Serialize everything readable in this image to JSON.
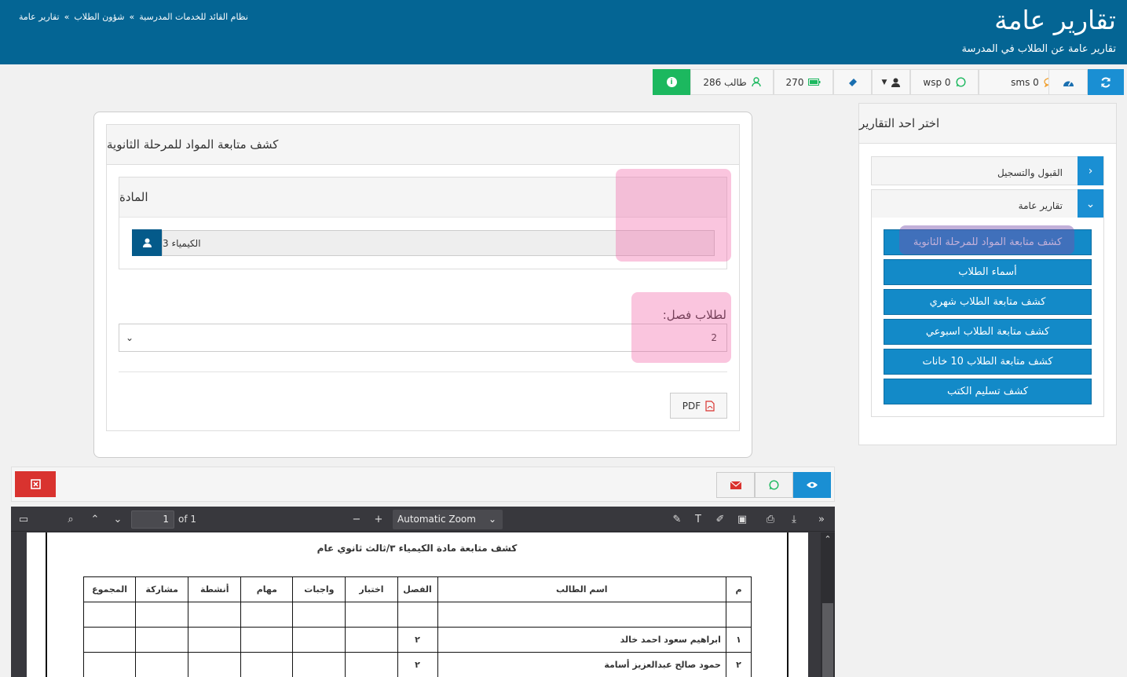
{
  "header": {
    "title": "تقارير عامة",
    "subtitle": "تقارير عامة عن الطلاب في المدرسة",
    "breadcrumb": [
      "نظام القائد للخدمات المدرسية",
      "شؤون الطلاب",
      "تقارير عامة"
    ],
    "separator": "»"
  },
  "toolbar": {
    "students": "286 طالب",
    "battery": "270",
    "wsp": "wsp 0",
    "sms": "sms 0"
  },
  "right_panel": {
    "title": "اختر احد التقارير",
    "sections": [
      {
        "label": "القبول والتسجيل",
        "expanded": false
      },
      {
        "label": "تقارير عامة",
        "expanded": true
      }
    ],
    "report_buttons": [
      "كشف متابعة المواد للمرحلة الثانوية",
      "أسماء الطلاب",
      "كشف متابعة الطلاب شهري",
      "كشف متابعة الطلاب اسبوعي",
      "كشف متابعة الطلاب 10 خانات",
      "كشف تسليم الكتب"
    ]
  },
  "form": {
    "title": "كشف متابعة المواد للمرحلة الثانوية",
    "subject_heading": "المادة",
    "subject_value": "الكيمياء 3",
    "class_label": "لطلاب فصل:",
    "class_value": "2",
    "pdf_label": "PDF"
  },
  "viewer": {
    "page_number": "1",
    "page_of": "of 1",
    "zoom": "Automatic Zoom",
    "doc_title": "كشف متابعة مادة الكيمياء ٣/ثالث ثانوي عام",
    "columns": [
      "م",
      "اسم الطالب",
      "الفصل",
      "اختبار",
      "واجبات",
      "مهام",
      "أنشطة",
      "مشاركة",
      "المجموع"
    ],
    "rows": [
      [
        "١",
        "ابراهيم سعود احمد خالد",
        "٢"
      ],
      [
        "٢",
        "حمود صالح عبدالعزيز أسامة",
        "٢"
      ]
    ]
  },
  "colors": {
    "header_bg": "#046594",
    "primary": "#1a8fd3",
    "success": "#1cb85f",
    "danger": "#d9332f",
    "highlight": "rgba(240,90,160,0.35)"
  }
}
